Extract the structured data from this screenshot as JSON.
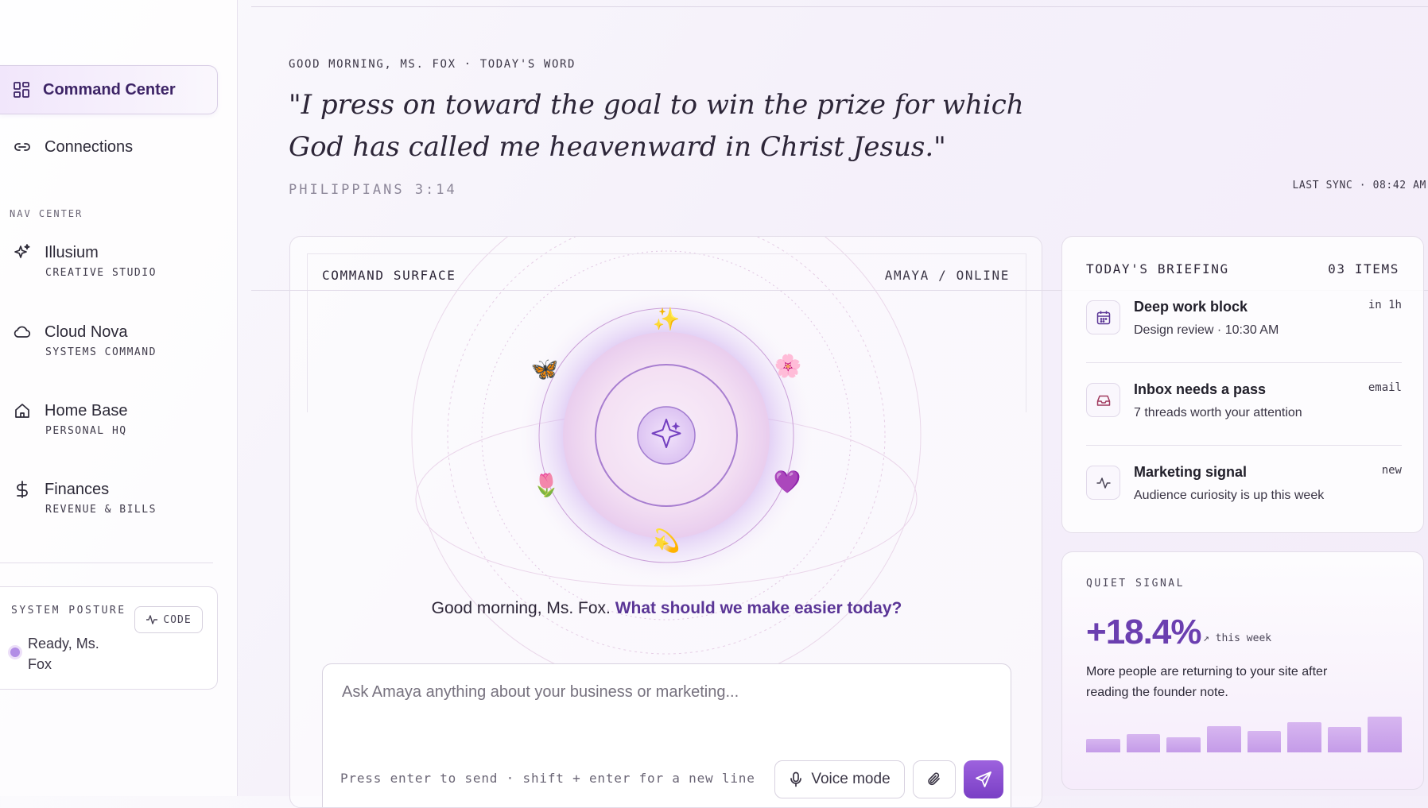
{
  "sidebar": {
    "active": {
      "label": "Command Center",
      "icon": "grid-icon"
    },
    "connections": {
      "label": "Connections",
      "icon": "link-icon"
    },
    "section_label": "NAV CENTER",
    "items": [
      {
        "label": "Illusium",
        "sub": "CREATIVE STUDIO",
        "icon": "sparkle-icon"
      },
      {
        "label": "Cloud Nova",
        "sub": "SYSTEMS COMMAND",
        "icon": "cloud-icon"
      },
      {
        "label": "Home Base",
        "sub": "PERSONAL HQ",
        "icon": "home-icon"
      },
      {
        "label": "Finances",
        "sub": "REVENUE & BILLS",
        "icon": "dollar-icon"
      }
    ],
    "posture": {
      "title": "SYSTEM POSTURE",
      "code_label": "CODE",
      "status": "Ready, Ms. Fox"
    }
  },
  "header": {
    "greeting": "GOOD MORNING, MS. FOX · TODAY'S WORD",
    "verse": "\"I press on toward the goal to win the prize for which God has called me heavenward in Christ Jesus.\"",
    "reference": "PHILIPPIANS 3:14",
    "sync": "LAST SYNC · 08:42 AM"
  },
  "surface": {
    "title": "COMMAND SURFACE",
    "status": "AMAYA / ONLINE",
    "prompt_plain": "Good morning, Ms. Fox.",
    "prompt_accent": "What should we make easier today?",
    "composer": {
      "placeholder": "Ask Amaya anything about your business or marketing...",
      "hint": "Press enter to send · shift + enter for a new line",
      "voice_label": "Voice mode"
    },
    "orbit_emojis": [
      "✨",
      "🌸",
      "💜",
      "💫",
      "🌷",
      "🦋"
    ]
  },
  "briefing": {
    "title": "TODAY'S BRIEFING",
    "count": "03 ITEMS",
    "items": [
      {
        "title": "Deep work block",
        "sub": "Design review · 10:30 AM",
        "meta": "in 1h",
        "icon": "calendar-icon"
      },
      {
        "title": "Inbox needs a pass",
        "sub": "7 threads worth your attention",
        "meta": "email",
        "icon": "inbox-icon"
      },
      {
        "title": "Marketing signal",
        "sub": "Audience curiosity is up this week",
        "meta": "new",
        "icon": "pulse-icon"
      }
    ]
  },
  "signal": {
    "title": "QUIET SIGNAL",
    "value": "+18.4%",
    "unit": "↗ this week",
    "description": "More people are returning to your site after reading the founder note.",
    "bars": [
      0.26,
      0.36,
      0.3,
      0.52,
      0.42,
      0.6,
      0.5,
      0.7
    ]
  },
  "colors": {
    "accent": "#7a3fc5",
    "accent_text": "#5a3596",
    "lavender": "#c49be8"
  }
}
